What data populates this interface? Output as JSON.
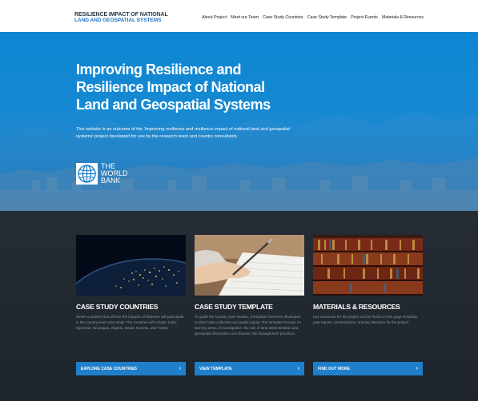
{
  "header": {
    "logo_line1": "RESILIENCE IMPACT OF NATIONAL",
    "logo_line2": "LAND AND GEOSPATIAL SYSTEMS",
    "nav": [
      {
        "label": "About Project"
      },
      {
        "label": "Meet our Team"
      },
      {
        "label": "Case Study Countries"
      },
      {
        "label": "Case Study Template"
      },
      {
        "label": "Project Events"
      },
      {
        "label": "Materials & Resources"
      }
    ]
  },
  "hero": {
    "title_lines": [
      "Improving Resilience and",
      "Resilience Impact of National",
      "Land and Geospatial Systems"
    ],
    "description": "This website is an outcome of the 'Improving resilience and resilience impact of national land and geospatial systems' project developed for use by the research team and country consultants",
    "logo_lines": [
      "THE",
      "WORLD",
      "BANK"
    ],
    "logo_icon": "world-bank-globe-icon"
  },
  "cards": [
    {
      "title": "CASE STUDY COUNTRIES",
      "text": "Seven countries that all face the impacts of disasters will participate in the country level case study. The countries will include: India, Myanmar, Nicaragua, Nigeria, Nepal, Norway, and Turkey.",
      "button": "EXPLORE CASE COUNTRIES",
      "image": "earth-night-lights"
    },
    {
      "title": "CASE STUDY TEMPLATE",
      "text": "To guide the country case studies, a template has been developed to direct data collection and guide inquiry. The template focuses on two key areas of investigation: the role of land administration and geospatial information and disaster risk management practices.",
      "button": "VIEW TEMPLATE",
      "image": "hand-writing-paper"
    },
    {
      "title": "MATERIALS & RESOURCES",
      "text": "Key resources for the project can be found on this page including past reports, presentations, and key literature for the project.",
      "button": "FIND OUT MORE",
      "image": "library-bookshelves"
    }
  ],
  "colors": {
    "hero_blue": "#0c86d3",
    "button_blue": "#1f7fca",
    "dark_bg": "#252c34"
  }
}
